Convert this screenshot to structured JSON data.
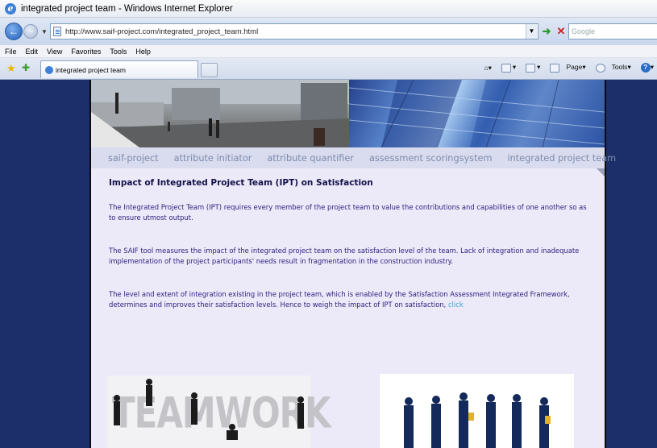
{
  "browser": {
    "window_title": "integrated project team - Windows Internet Explorer",
    "address": "http://www.saif-project.com/integrated_project_team.html",
    "search_placeholder": "Google",
    "menu": [
      "File",
      "Edit",
      "View",
      "Favorites",
      "Tools",
      "Help"
    ],
    "tab_title": "integrated project team",
    "command_bar": {
      "page_label": "Page",
      "tools_label": "Tools"
    }
  },
  "site": {
    "nav": [
      "saif-project",
      "attribute initiator",
      "attribute quantifier",
      "assessment scoringsystem",
      "integrated project team"
    ],
    "heading": "Impact of Integrated Project Team (IPT) on Satisfaction",
    "paragraphs": [
      "The Integrated Project Team (IPT) requires every member of the project team to value the contributions and capabilities of one another so as to ensure utmost output.",
      "The SAIF tool measures the impact of the integrated project team on the satisfaction level of the team.  Lack of integration and inadequate implementation of the project participants' needs result in fragmentation in the construction industry."
    ],
    "paragraph3_text": "The level and extent of integration existing in the project team, which is enabled by the Satisfaction Assessment Integrated Framework, determines and improves their satisfaction levels.  Hence to weigh the impact of IPT on satisfaction, ",
    "paragraph3_link": "click",
    "teamwork_word": "TEAMWORK"
  },
  "colors": {
    "page_background": "#1d2f6b",
    "content_background": "#ece9f8",
    "nav_text": "#7b8aac",
    "body_text": "#2d2480",
    "link": "#3aa5d8"
  }
}
